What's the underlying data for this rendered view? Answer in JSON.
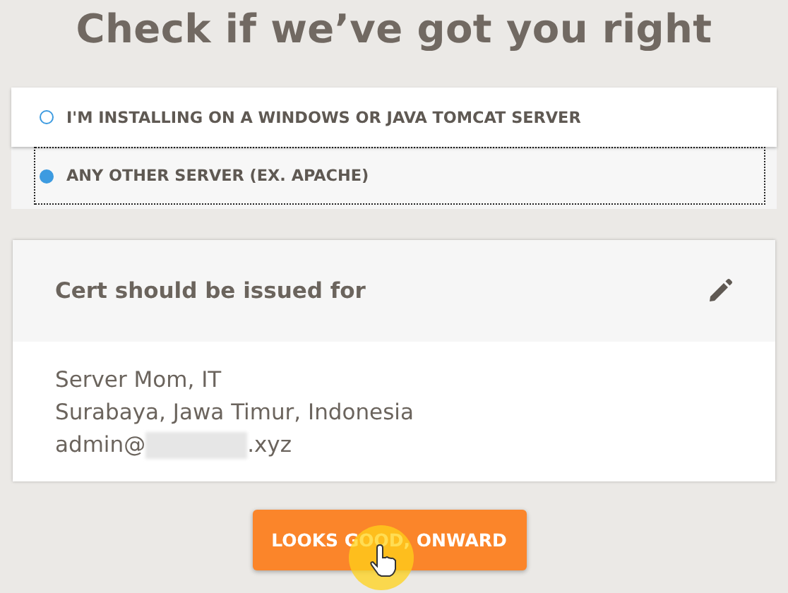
{
  "title": "Check if we’ve got you right",
  "server_options": [
    {
      "label": "I'M INSTALLING ON A WINDOWS OR JAVA TOMCAT SERVER",
      "selected": false,
      "focused": false
    },
    {
      "label": "ANY OTHER SERVER (EX. APACHE)",
      "selected": true,
      "focused": true
    }
  ],
  "cert_card": {
    "heading": "Cert should be issued for",
    "lines": [
      "Server Mom, IT",
      "Surabaya, Jawa Timur, Indonesia"
    ],
    "email_prefix": "admin@",
    "email_suffix": ".xyz"
  },
  "button": "LOOKS GOOD, ONWARD"
}
